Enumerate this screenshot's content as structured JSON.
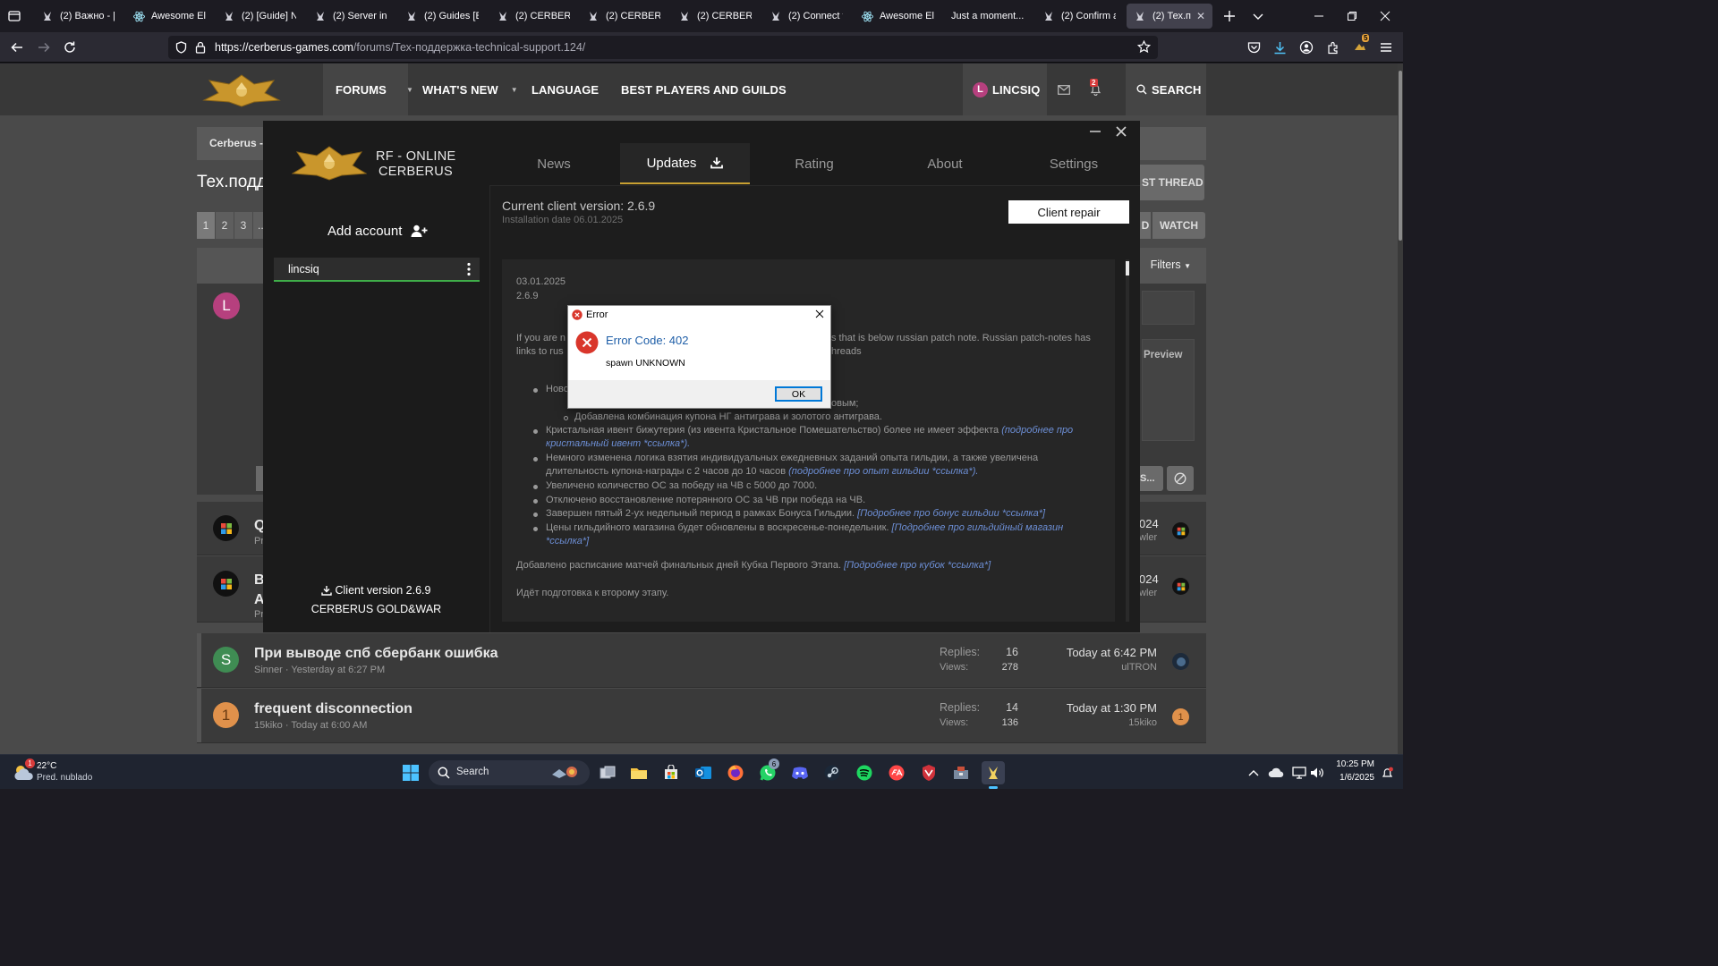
{
  "browser": {
    "tabs": [
      {
        "title": "(2) Важно - [S",
        "favicon": "cerberus-icon"
      },
      {
        "title": "Awesome Elec",
        "favicon": "electron-icon"
      },
      {
        "title": "(2) [Guide] Ne",
        "favicon": "cerberus-icon"
      },
      {
        "title": "(2) Server inga",
        "favicon": "cerberus-icon"
      },
      {
        "title": "(2) Guides [EN",
        "favicon": "cerberus-icon"
      },
      {
        "title": "(2) CERBERUS",
        "favicon": "cerberus-icon"
      },
      {
        "title": "(2) CERBERUS",
        "favicon": "cerberus-icon"
      },
      {
        "title": "(2) CERBERUS",
        "favicon": "cerberus-icon"
      },
      {
        "title": "(2) Connect to",
        "favicon": "cerberus-icon"
      },
      {
        "title": "Awesome Elec",
        "favicon": "electron-icon"
      },
      {
        "title": "Just a moment...",
        "favicon": "blank-icon"
      },
      {
        "title": "(2) Confirm ac",
        "favicon": "cerberus-icon"
      },
      {
        "title": "(2) Тех.подд",
        "favicon": "cerberus-icon",
        "active": true
      }
    ],
    "url_domain": "https://cerberus-games.com",
    "url_path": "/forums/Тех-поддержка-technical-support.124/",
    "download_badge": "",
    "ext_badge": "5"
  },
  "forum": {
    "nav": {
      "forums": "FORUMS",
      "whats_new": "WHAT'S NEW",
      "language": "LANGUAGE",
      "best_players": "BEST PLAYERS AND GUILDS",
      "username": "LINCSIQ",
      "user_initial": "L",
      "alerts_count": "2",
      "search": "SEARCH"
    },
    "breadcrumb_visible": "Cerberus -",
    "page_title_visible": "Тех.подд",
    "post_thread_visible": "ST THREAD",
    "pages": [
      "1",
      "2",
      "3",
      "..."
    ],
    "watch_partial": "D",
    "watch": "WATCH",
    "filters": "Filters",
    "preview": "Preview",
    "composer_user_initial": "L",
    "action_partial": "S...",
    "threads": [
      {
        "title_partial": "Q",
        "meta_partial": "Pr",
        "date_partial": "024",
        "user_partial": "wler",
        "avatar": "windows-avatar"
      },
      {
        "title_partial": "B",
        "title_partial2": "A",
        "meta_partial": "Pr",
        "date_partial": "024",
        "user_partial": "wler",
        "avatar": "windows-avatar"
      },
      {
        "title": "При выводе спб сбербанк ошибка",
        "author": "Sinner",
        "created": "Yesterday at 6:27 PM",
        "replies_label": "Replies:",
        "replies": "16",
        "views_label": "Views:",
        "views": "278",
        "last_time": "Today at 6:42 PM",
        "last_user": "ulTRON",
        "initial": "S",
        "color": "#3f8c53"
      },
      {
        "title": "frequent disconnection",
        "author": "15kiko",
        "created": "Today at 6:00 AM",
        "replies_label": "Replies:",
        "replies": "14",
        "views_label": "Views:",
        "views": "136",
        "last_time": "Today at 1:30 PM",
        "last_user": "15kiko",
        "initial": "1",
        "color": "#e0914b"
      }
    ]
  },
  "launcher": {
    "brand_line1": "RF - ONLINE",
    "brand_line2": "CERBERUS",
    "tabs": [
      "News",
      "Updates",
      "Rating",
      "About",
      "Settings"
    ],
    "active_tab": "Updates",
    "add_account": "Add account",
    "account": "lincsiq",
    "client_version_label": "Client version 2.6.9",
    "gold_war": "CERBERUS GOLD&WAR",
    "current_version": "Current client version: 2.6.9",
    "install_date": "Installation date 06.01.2025",
    "repair_button": "Client repair",
    "notes": {
      "date": "03.01.2025",
      "version": "2.6.9",
      "intro_left_1": "If you are n",
      "intro_right_1": "s that is below russian patch note. Russian patch-notes has",
      "intro_left_2": "links to rus",
      "intro_right_2": "hreads",
      "bullet_new_partial": "Ново",
      "sub_partial": "овым;",
      "sub2": "Добавлена комбинация купона НГ антиграва и золотого антиграва.",
      "b1": "Кристальная ивент бижутерия (из ивента Кристальное Помешательство) более не имеет эффекта",
      "b1_link_a": "(подробнее про",
      "b1_link_b": "кристальный ивент *ссылка*).",
      "b2a": "Немного изменена логика взятия индивидуальных ежедневных заданий опыта гильдии, а также увеличена",
      "b2b": "длительность купона-награды с 2 часов до 10 часов",
      "b2_link": "(подробнее про опыт гильдии *ссылка*).",
      "b3": "Увеличено количество ОС за победу на ЧВ с 5000 до 7000.",
      "b4": "Отключено восстановление потерянного ОС за ЧВ при победа на ЧВ.",
      "b5": "Завершен пятый 2-ух недельный период в рамках Бонуса Гильдии.",
      "b5_link": "[Подробнее про бонус гильдии *ссылка*]",
      "b6": "Цены гильдийного магазина будет обновлены в воскресенье-понедельник.",
      "b6_link_a": "[Подробнее про гильдийный магазин",
      "b6_link_b": "*ссылка*]",
      "p1": "Добавлено расписание матчей финальных дней Кубка Первого Этапа.",
      "p1_link": "[Подробнее про кубок *ссылка*]",
      "p2": "Идёт подготовка к второму этапу."
    }
  },
  "error_dialog": {
    "title": "Error",
    "heading": "Error Code: 402",
    "message": "spawn UNKNOWN",
    "ok": "OK"
  },
  "taskbar": {
    "weather_temp": "22°C",
    "weather_desc": "Pred. nublado",
    "weather_badge": "1",
    "search": "Search",
    "whatsapp_badge": "6",
    "time": "10:25 PM",
    "date": "1/6/2025"
  },
  "colors": {
    "launcher_bg": "#1b1b1b",
    "accent_gold": "#c8a032",
    "account_green": "#3fae49",
    "forum_bg": "#4a4a4a",
    "link_blue": "#6d8fd6",
    "error_red": "#d9362b",
    "dialog_heading_blue": "#1f5fa8"
  }
}
